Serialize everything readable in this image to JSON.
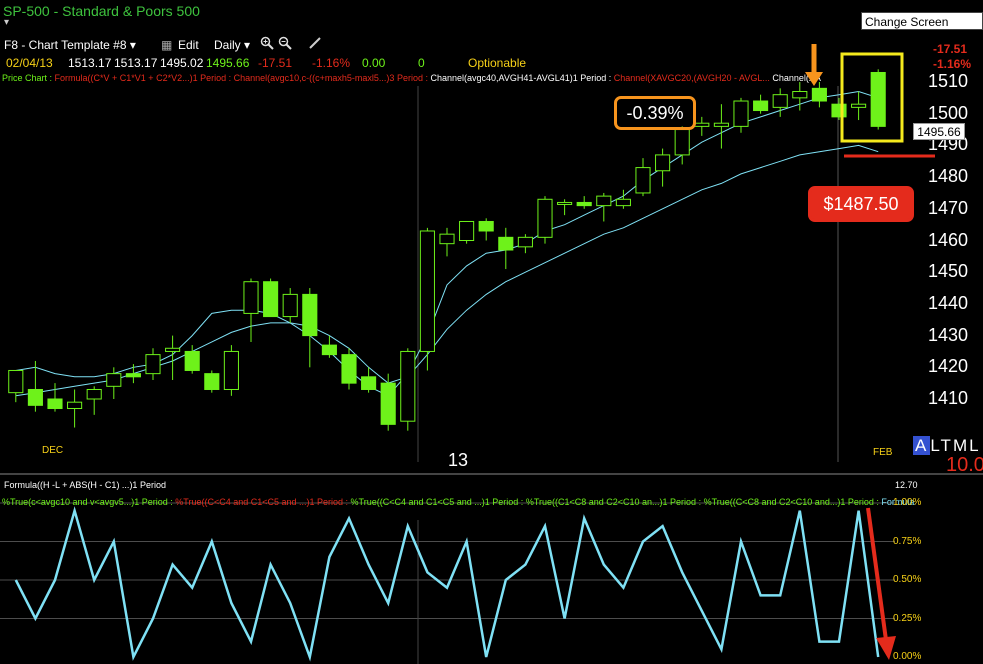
{
  "window": {
    "title": "SP-500 - Standard & Poors 500",
    "tooltip": "Change Screen Layout"
  },
  "toolbar": {
    "template": "F8 - Chart Template #8",
    "edit": "Edit",
    "interval": "Daily",
    "zoom_in_icon": "zoom-in-icon",
    "zoom_out_icon": "zoom-out-icon",
    "draw_icon": "pencil-icon"
  },
  "quote": {
    "date": "02/04/13",
    "open": "1513.17",
    "high": "1513.17",
    "low": "1495.02",
    "last": "1495.66",
    "change": "-17.51",
    "pct_change": "-1.16%",
    "v1": "0.00",
    "v2": "0",
    "optionable": "Optionable",
    "right_change": "-17.51",
    "right_pct": "-1.16%"
  },
  "studies": {
    "label": "Price Chart :",
    "items": [
      {
        "text": "Formula((C*V + C1*V1 + C2*V2...)1 Period :",
        "color": "#e42b1c"
      },
      {
        "text": "Channel(avgc10,c-((c+maxh5-maxl5...)3 Period :",
        "color": "#e42b1c"
      },
      {
        "text": "Channel(avgc40,AVGH41-AVGL41)1 Period :",
        "color": "#ffffff"
      },
      {
        "text": "Channel(XAVGC20,(AVGH20 - AVGL...",
        "color": "#e42b1c"
      },
      {
        "text": "Channel(XA",
        "color": "#ffffff"
      }
    ]
  },
  "price_axis": {
    "labels": [
      "1510",
      "1500",
      "1490",
      "1480",
      "1470",
      "1460",
      "1450",
      "1440",
      "1430",
      "1420",
      "1410"
    ],
    "last_price": "1495.66"
  },
  "time_axis": {
    "dec": "DEC",
    "thirteen": "13",
    "feb": "FEB"
  },
  "annotations": {
    "pct_callout": "-0.39%",
    "price_callout": "$1487.50",
    "colors": {
      "orange": "#f7941d",
      "red": "#e42b1c",
      "yellow": "#f5ea1d",
      "green": "#6ef21a",
      "cyan": "#7fe1f5"
    }
  },
  "sidebar_right": {
    "altml": [
      "A",
      "L",
      "T",
      "M",
      "L"
    ],
    "value": "10.0"
  },
  "indicator": {
    "label": "Formula((H -L + ABS(H - C1) ...)1 Period",
    "value": "12.70",
    "studies": [
      {
        "text": "%True(c<avgc10 and v<avgv5...)1 Period :",
        "color": "#6ef21a"
      },
      {
        "text": "%True((C<C4 and C1<C5 and ...)1 Period :",
        "color": "#e42b1c"
      },
      {
        "text": "%True((C<C4 and C1<C5 and ...)1 Period :",
        "color": "#6ef21a"
      },
      {
        "text": "%True((C1<C8 and C2<C10 an...)1 Period :",
        "color": "#6ef21a"
      },
      {
        "text": "%True((C<C8 and C2<C10 and...)1 Period :",
        "color": "#6ef21a"
      },
      {
        "text": "Formula",
        "color": "#7fe1f5"
      }
    ],
    "axis": [
      "1.00%",
      "0.75%",
      "0.50%",
      "0.25%",
      "0.00%"
    ]
  },
  "chart_data": {
    "type": "candlestick",
    "ylim": [
      1400,
      1515
    ],
    "candles": [
      {
        "o": 1412,
        "h": 1417,
        "l": 1409,
        "c": 1419,
        "up": true
      },
      {
        "o": 1413,
        "h": 1422,
        "l": 1406,
        "c": 1408,
        "up": false
      },
      {
        "o": 1410,
        "h": 1415,
        "l": 1406,
        "c": 1407,
        "up": false
      },
      {
        "o": 1407,
        "h": 1413,
        "l": 1401,
        "c": 1409,
        "up": true
      },
      {
        "o": 1410,
        "h": 1414,
        "l": 1405,
        "c": 1413,
        "up": true
      },
      {
        "o": 1414,
        "h": 1420,
        "l": 1410,
        "c": 1418,
        "up": true
      },
      {
        "o": 1418,
        "h": 1421,
        "l": 1415,
        "c": 1417,
        "up": false
      },
      {
        "o": 1418,
        "h": 1426,
        "l": 1416,
        "c": 1424,
        "up": true
      },
      {
        "o": 1426,
        "h": 1430,
        "l": 1416,
        "c": 1425,
        "up": true
      },
      {
        "o": 1425,
        "h": 1427,
        "l": 1418,
        "c": 1419,
        "up": false
      },
      {
        "o": 1418,
        "h": 1419,
        "l": 1412,
        "c": 1413,
        "up": false
      },
      {
        "o": 1413,
        "h": 1427,
        "l": 1411,
        "c": 1425,
        "up": true
      },
      {
        "o": 1437,
        "h": 1448,
        "l": 1428,
        "c": 1447,
        "up": true
      },
      {
        "o": 1447,
        "h": 1448,
        "l": 1436,
        "c": 1436,
        "up": false
      },
      {
        "o": 1436,
        "h": 1445,
        "l": 1434,
        "c": 1443,
        "up": true
      },
      {
        "o": 1443,
        "h": 1445,
        "l": 1420,
        "c": 1430,
        "up": false
      },
      {
        "o": 1427,
        "h": 1430,
        "l": 1423,
        "c": 1424,
        "up": false
      },
      {
        "o": 1424,
        "h": 1426,
        "l": 1413,
        "c": 1415,
        "up": false
      },
      {
        "o": 1417,
        "h": 1420,
        "l": 1412,
        "c": 1413,
        "up": false
      },
      {
        "o": 1415,
        "h": 1418,
        "l": 1400,
        "c": 1402,
        "up": false
      },
      {
        "o": 1403,
        "h": 1426,
        "l": 1400,
        "c": 1425,
        "up": true
      },
      {
        "o": 1425,
        "h": 1464,
        "l": 1419,
        "c": 1463,
        "up": true
      },
      {
        "o": 1459,
        "h": 1464,
        "l": 1455,
        "c": 1462,
        "up": true
      },
      {
        "o": 1460,
        "h": 1466,
        "l": 1459,
        "c": 1466,
        "up": true
      },
      {
        "o": 1466,
        "h": 1467,
        "l": 1460,
        "c": 1463,
        "up": false
      },
      {
        "o": 1461,
        "h": 1464,
        "l": 1451,
        "c": 1457,
        "up": false
      },
      {
        "o": 1458,
        "h": 1462,
        "l": 1456,
        "c": 1461,
        "up": true
      },
      {
        "o": 1461,
        "h": 1474,
        "l": 1459,
        "c": 1473,
        "up": true
      },
      {
        "o": 1472,
        "h": 1473,
        "l": 1468,
        "c": 1472,
        "up": true
      },
      {
        "o": 1472,
        "h": 1474,
        "l": 1470,
        "c": 1471,
        "up": false
      },
      {
        "o": 1471,
        "h": 1475,
        "l": 1466,
        "c": 1474,
        "up": true
      },
      {
        "o": 1473,
        "h": 1476,
        "l": 1470,
        "c": 1471,
        "up": true
      },
      {
        "o": 1475,
        "h": 1486,
        "l": 1474,
        "c": 1483,
        "up": true
      },
      {
        "o": 1482,
        "h": 1489,
        "l": 1477,
        "c": 1487,
        "up": true
      },
      {
        "o": 1487,
        "h": 1496,
        "l": 1484,
        "c": 1495,
        "up": true
      },
      {
        "o": 1496,
        "h": 1499,
        "l": 1493,
        "c": 1497,
        "up": true
      },
      {
        "o": 1497,
        "h": 1503,
        "l": 1489,
        "c": 1496,
        "up": true
      },
      {
        "o": 1496,
        "h": 1505,
        "l": 1494,
        "c": 1504,
        "up": true
      },
      {
        "o": 1504,
        "h": 1506,
        "l": 1500,
        "c": 1501,
        "up": false
      },
      {
        "o": 1502,
        "h": 1508,
        "l": 1499,
        "c": 1506,
        "up": true
      },
      {
        "o": 1507,
        "h": 1510,
        "l": 1501,
        "c": 1505,
        "up": true
      },
      {
        "o": 1508,
        "h": 1510,
        "l": 1502,
        "c": 1504,
        "up": false
      },
      {
        "o": 1503,
        "h": 1505,
        "l": 1498,
        "c": 1499,
        "up": false
      },
      {
        "o": 1502,
        "h": 1507,
        "l": 1498,
        "c": 1503,
        "up": true
      },
      {
        "o": 1513,
        "h": 1514,
        "l": 1495,
        "c": 1496,
        "up": false
      }
    ],
    "ma_fast": [
      1419,
      1420,
      1418,
      1417,
      1417,
      1418,
      1420,
      1421,
      1424,
      1430,
      1437,
      1438,
      1438,
      1437,
      1434,
      1430,
      1425,
      1419,
      1414,
      1411,
      1418,
      1430,
      1446,
      1452,
      1456,
      1457,
      1459,
      1463,
      1465,
      1468,
      1471,
      1474,
      1479,
      1483,
      1487,
      1491,
      1494,
      1497,
      1499,
      1501,
      1503,
      1505,
      1506,
      1507,
      1505
    ],
    "ma_slow": [
      1411,
      1412,
      1413,
      1414,
      1415,
      1416,
      1418,
      1420,
      1422,
      1425,
      1428,
      1431,
      1433,
      1434,
      1434,
      1433,
      1430,
      1426,
      1420,
      1415,
      1417,
      1424,
      1432,
      1438,
      1443,
      1447,
      1450,
      1453,
      1456,
      1459,
      1462,
      1464,
      1467,
      1470,
      1473,
      1476,
      1478,
      1481,
      1483,
      1485,
      1487,
      1488,
      1489,
      1490,
      1488
    ],
    "indicator": [
      0.5,
      0.25,
      0.5,
      0.95,
      0.5,
      0.75,
      0.0,
      0.25,
      0.6,
      0.45,
      0.75,
      0.35,
      0.1,
      0.6,
      0.35,
      0.0,
      0.65,
      0.9,
      0.6,
      0.35,
      0.85,
      0.55,
      0.45,
      0.75,
      0.0,
      0.5,
      0.6,
      0.85,
      0.25,
      0.9,
      0.6,
      0.45,
      0.75,
      0.85,
      0.55,
      0.3,
      0.05,
      0.75,
      0.4,
      0.4,
      0.95,
      0.1,
      0.1,
      0.95,
      0.0
    ]
  }
}
